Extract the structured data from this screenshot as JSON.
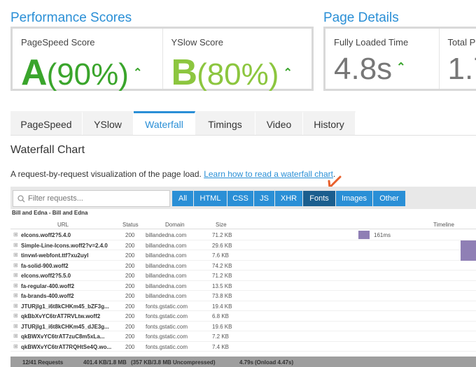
{
  "performance": {
    "title": "Performance Scores",
    "pagespeed": {
      "label": "PageSpeed Score",
      "grade": "A",
      "percent": "(90%)"
    },
    "yslow": {
      "label": "YSlow Score",
      "grade": "B",
      "percent": "(80%)"
    }
  },
  "details": {
    "title": "Page Details",
    "load_time": {
      "label": "Fully Loaded Time",
      "value": "4.8s"
    },
    "total": {
      "label": "Total P",
      "value": "1.7"
    }
  },
  "tabs": [
    "PageSpeed",
    "YSlow",
    "Waterfall",
    "Timings",
    "Video",
    "History"
  ],
  "active_tab": "Waterfall",
  "waterfall": {
    "heading": "Waterfall Chart",
    "description": "A request-by-request visualization of the page load.",
    "learn_link": "Learn how to read a waterfall chart",
    "desc_suffix": ".",
    "filter_placeholder": "Filter requests...",
    "filters": [
      "All",
      "HTML",
      "CSS",
      "JS",
      "XHR",
      "Fonts",
      "Images",
      "Other"
    ],
    "active_filter": "Fonts",
    "page_name": "Bill and Edna - Bill and Edna",
    "columns": {
      "url": "URL",
      "status": "Status",
      "domain": "Domain",
      "size": "Size",
      "timeline": "Timeline"
    },
    "rows": [
      {
        "url": "elcons.woff2?5.4.0",
        "status": "200",
        "domain": "billandedna.com",
        "size": "71.2 KB",
        "bar_label": "161ms"
      },
      {
        "url": "Simple-Line-Icons.woff2?v=2.4.0",
        "status": "200",
        "domain": "billandedna.com",
        "size": "29.6 KB",
        "bar_label": ""
      },
      {
        "url": "tinvwl-webfont.ttf?xu2uyl",
        "status": "200",
        "domain": "billandedna.com",
        "size": "7.6 KB",
        "bar_label": ""
      },
      {
        "url": "fa-solid-900.woff2",
        "status": "200",
        "domain": "billandedna.com",
        "size": "74.2 KB",
        "bar_label": ""
      },
      {
        "url": "elcons.woff2?5.5.0",
        "status": "200",
        "domain": "billandedna.com",
        "size": "71.2 KB",
        "bar_label": ""
      },
      {
        "url": "fa-regular-400.woff2",
        "status": "200",
        "domain": "billandedna.com",
        "size": "13.5 KB",
        "bar_label": ""
      },
      {
        "url": "fa-brands-400.woff2",
        "status": "200",
        "domain": "billandedna.com",
        "size": "73.8 KB",
        "bar_label": ""
      },
      {
        "url": "JTURjIg1_i6t8kCHKm45_bZF3g...",
        "status": "200",
        "domain": "fonts.gstatic.com",
        "size": "19.4 KB",
        "bar_label": ""
      },
      {
        "url": "qkBbXvYC6trAT7RVLtw.woff2",
        "status": "200",
        "domain": "fonts.gstatic.com",
        "size": "6.8 KB",
        "bar_label": ""
      },
      {
        "url": "JTURjIg1_i6t8kCHKm45_dJE3g...",
        "status": "200",
        "domain": "fonts.gstatic.com",
        "size": "19.6 KB",
        "bar_label": ""
      },
      {
        "url": "qkBWXvYC6trAT7zuC8m5xLa...",
        "status": "200",
        "domain": "fonts.gstatic.com",
        "size": "7.2 KB",
        "bar_label": ""
      },
      {
        "url": "qkBWXvYC6trAT7RQHtSe4Q.wo...",
        "status": "200",
        "domain": "fonts.gstatic.com",
        "size": "7.4 KB",
        "bar_label": ""
      }
    ],
    "summary": {
      "requests": "12/41 Requests",
      "size": "401.4 KB/1.8 MB",
      "uncompressed": "(357 KB/3.8 MB Uncompressed)",
      "time": "4.79s",
      "onload": "(Onload 4.47s)"
    }
  },
  "colors": {
    "accent": "#2a8fd6",
    "grade_a": "#3aa52c",
    "grade_b": "#8cc63f",
    "bar": "#8f7fb5",
    "active_filter": "#1b5e8e",
    "arrow": "#e8602c"
  }
}
